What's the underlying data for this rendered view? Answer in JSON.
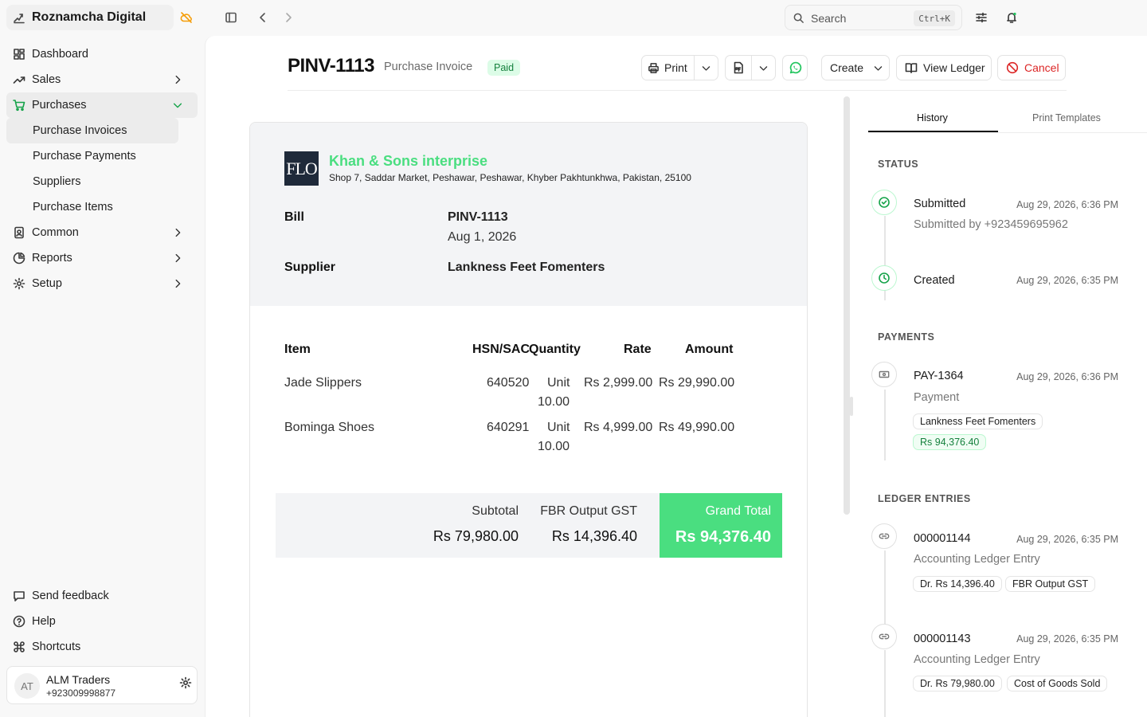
{
  "app": {
    "name": "Roznamcha Digital"
  },
  "sidebar": {
    "items": [
      {
        "label": "Dashboard"
      },
      {
        "label": "Sales"
      },
      {
        "label": "Purchases"
      },
      {
        "label": "Common"
      },
      {
        "label": "Reports"
      },
      {
        "label": "Setup"
      }
    ],
    "purchases_sub": [
      {
        "label": "Purchase Invoices"
      },
      {
        "label": "Purchase Payments"
      },
      {
        "label": "Suppliers"
      },
      {
        "label": "Purchase Items"
      }
    ],
    "bottom": [
      {
        "label": "Send feedback"
      },
      {
        "label": "Help"
      },
      {
        "label": "Shortcuts"
      }
    ],
    "user": {
      "initials": "AT",
      "name": "ALM Traders",
      "phone": "+923009998877"
    }
  },
  "topbar": {
    "search_placeholder": "Search",
    "search_shortcut": "Ctrl+K"
  },
  "doc": {
    "id": "PINV-1113",
    "type": "Purchase Invoice",
    "status": "Paid",
    "buttons": {
      "print": "Print",
      "create": "Create",
      "view_ledger": "View Ledger",
      "cancel": "Cancel"
    }
  },
  "invoice": {
    "company_logo_text": "FLO",
    "company_name": "Khan & Sons interprise",
    "company_address": "Shop 7, Saddar Market, Peshawar, Peshawar, Khyber Pakhtunkhwa, Pakistan, 25100",
    "bill_label": "Bill",
    "bill_no": "PINV-1113",
    "bill_date": "Aug 1, 2026",
    "supplier_label": "Supplier",
    "supplier_name": "Lankness Feet Fomenters",
    "columns": {
      "item": "Item",
      "hsn": "HSN/SAC",
      "qty": "Quantity",
      "rate": "Rate",
      "amount": "Amount"
    },
    "rows": [
      {
        "item": "Jade Slippers",
        "hsn": "640520",
        "unit": "Unit",
        "qty": "10.00",
        "rate": "Rs 2,999.00",
        "amount": "Rs 29,990.00"
      },
      {
        "item": "Bominga Shoes",
        "hsn": "640291",
        "unit": "Unit",
        "qty": "10.00",
        "rate": "Rs 4,999.00",
        "amount": "Rs 49,990.00"
      }
    ],
    "subtotal_label": "Subtotal",
    "subtotal": "Rs 79,980.00",
    "tax_label": "FBR Output GST",
    "tax": "Rs 14,396.40",
    "grand_total_label": "Grand Total",
    "grand_total": "Rs 94,376.40"
  },
  "panel": {
    "tabs": [
      {
        "label": "History"
      },
      {
        "label": "Print Templates"
      }
    ],
    "status_header": "STATUS",
    "status": [
      {
        "title": "Submitted",
        "time": "Aug 29, 2026, 6:36 PM",
        "sub": "Submitted by +923459695962"
      },
      {
        "title": "Created",
        "time": "Aug 29, 2026, 6:35 PM"
      }
    ],
    "payments_header": "PAYMENTS",
    "payments": [
      {
        "title": "PAY-1364",
        "time": "Aug 29, 2026, 6:36 PM",
        "sub": "Payment",
        "party": "Lankness Feet Fomenters",
        "amount": "Rs 94,376.40"
      }
    ],
    "ledger_header": "LEDGER ENTRIES",
    "ledger": [
      {
        "title": "000001144",
        "time": "Aug 29, 2026, 6:35 PM",
        "sub": "Accounting Ledger Entry",
        "amount": "Dr. Rs 14,396.40",
        "account": "FBR Output GST"
      },
      {
        "title": "000001143",
        "time": "Aug 29, 2026, 6:35 PM",
        "sub": "Accounting Ledger Entry",
        "amount": "Dr. Rs 79,980.00",
        "account": "Cost of Goods Sold"
      }
    ]
  },
  "colors": {
    "accent": "#4ade80",
    "paid_bg": "#dcfce7",
    "cancel": "#dc2626",
    "whatsapp": "#22c55e"
  }
}
